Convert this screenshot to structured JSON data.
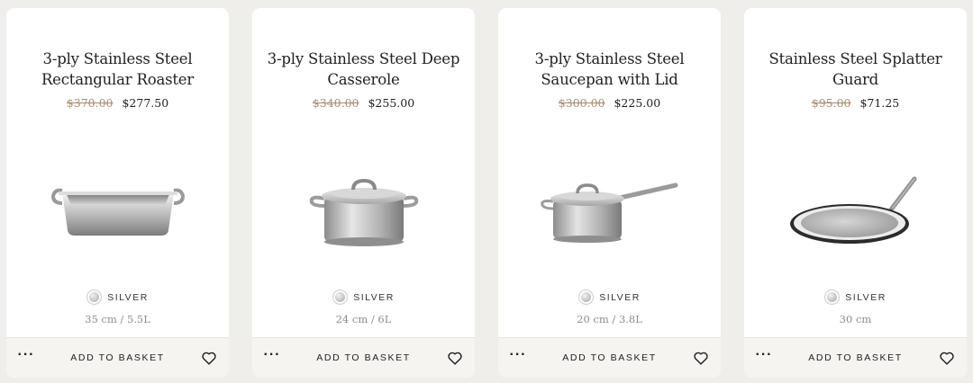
{
  "actions": {
    "more_label": "···",
    "basket_label": "ADD TO BASKET"
  },
  "products": [
    {
      "title": "3-ply Stainless Steel Rectangular Roaster",
      "old_price": "$370.00",
      "price": "$277.50",
      "color_label": "SILVER",
      "size": "35 cm / 5.5L",
      "image": "roaster"
    },
    {
      "title": "3-ply Stainless Steel Deep Casserole",
      "old_price": "$340.00",
      "price": "$255.00",
      "color_label": "SILVER",
      "size": "24 cm / 6L",
      "image": "casserole"
    },
    {
      "title": "3-ply Stainless Steel Saucepan with Lid",
      "old_price": "$300.00",
      "price": "$225.00",
      "color_label": "SILVER",
      "size": "20 cm / 3.8L",
      "image": "saucepan"
    },
    {
      "title": "Stainless Steel Splatter Guard",
      "old_price": "$95.00",
      "price": "$71.25",
      "color_label": "SILVER",
      "size": "30 cm",
      "image": "splatter-guard"
    }
  ]
}
